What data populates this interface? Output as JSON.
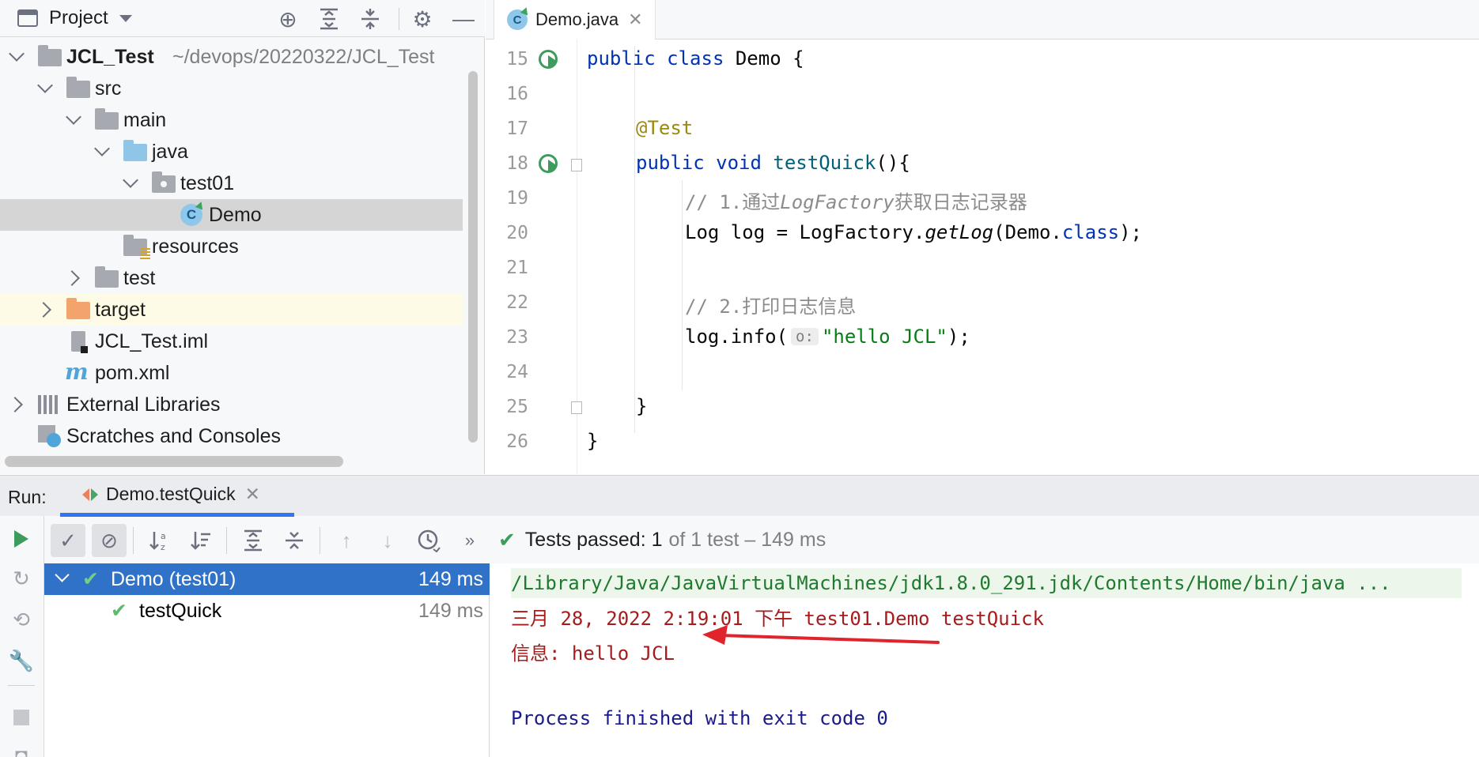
{
  "project_panel": {
    "title": "Project",
    "tree": [
      {
        "label": "JCL_Test",
        "hint": "~/devops/20220322/JCL_Test"
      },
      {
        "label": "src"
      },
      {
        "label": "main"
      },
      {
        "label": "java"
      },
      {
        "label": "test01"
      },
      {
        "label": "Demo"
      },
      {
        "label": "resources"
      },
      {
        "label": "test"
      },
      {
        "label": "target"
      },
      {
        "label": "JCL_Test.iml"
      },
      {
        "label": "pom.xml"
      },
      {
        "label": "External Libraries"
      },
      {
        "label": "Scratches and Consoles"
      }
    ],
    "icons": {
      "locate": "crosshair-icon",
      "expand": "expand-all-icon",
      "collapse": "collapse-all-icon",
      "settings": "gear-icon",
      "hide": "minimize-icon"
    }
  },
  "editor": {
    "tab_label": "Demo.java",
    "class_icon_letter": "C",
    "line_numbers": [
      "15",
      "16",
      "17",
      "18",
      "19",
      "20",
      "21",
      "22",
      "23",
      "24",
      "25",
      "26"
    ],
    "code": {
      "l15_kw1": "public",
      "l15_kw2": "class",
      "l15_rest": " Demo {",
      "l17_ann": "@Test",
      "l18_kw1": "public",
      "l18_kw2": "void",
      "l18_fn": "testQuick",
      "l18_rest": "(){",
      "l19_cmt_a": "// 1.通过",
      "l19_cmt_b": "LogFactory",
      "l19_cmt_c": "获取日志记录器",
      "l20_a": "Log log = LogFactory.",
      "l20_b": "getLog",
      "l20_c": "(Demo.",
      "l20_d": "class",
      "l20_e": ");",
      "l22_cmt": "// 2.打印日志信息",
      "l23_a": "log.info(",
      "l23_hint": "o:",
      "l23_str": "\"hello JCL\"",
      "l23_b": ");",
      "l25": "}",
      "l26": "}"
    },
    "colors": {
      "keyword": "#0033b3",
      "annotation": "#9e880d",
      "method": "#00627a",
      "comment": "#8c8c8c",
      "string": "#067d17"
    }
  },
  "run_panel": {
    "label": "Run:",
    "tab_label": "Demo.testQuick",
    "status_prefix": "Tests passed:",
    "status_count": "1",
    "status_rest": "of 1 test – 149 ms",
    "tests": [
      {
        "name": "Demo (test01)",
        "time": "149 ms"
      },
      {
        "name": "testQuick",
        "time": "149 ms"
      }
    ],
    "console": [
      "/Library/Java/JavaVirtualMachines/jdk1.8.0_291.jdk/Contents/Home/bin/java ...",
      "三月 28, 2022 2:19:01 下午 test01.Demo testQuick",
      "信息: hello JCL",
      "Process finished with exit code 0"
    ],
    "colors": {
      "selection": "#2f72c8",
      "pass": "#3d9c5c",
      "stderr": "#a61c1c",
      "annotation_arrow": "#e0242b"
    }
  }
}
